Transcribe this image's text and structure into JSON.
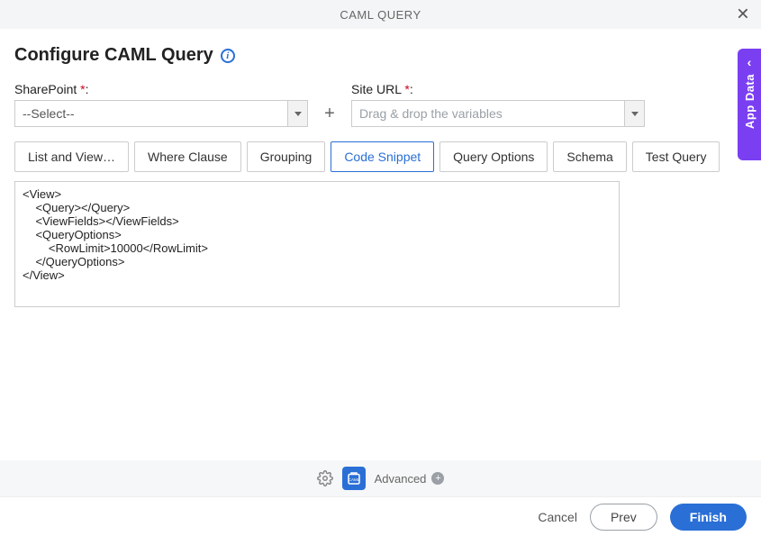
{
  "header": {
    "title": "CAML QUERY"
  },
  "page": {
    "title": "Configure CAML Query"
  },
  "fields": {
    "sharepoint": {
      "label": "SharePoint",
      "required": "*",
      "value": "--Select--"
    },
    "site_url": {
      "label": "Site URL",
      "required": "*",
      "placeholder": "Drag & drop the variables"
    }
  },
  "tabs": {
    "items": [
      {
        "label": "List and View…"
      },
      {
        "label": "Where Clause"
      },
      {
        "label": "Grouping"
      },
      {
        "label": "Code Snippet"
      },
      {
        "label": "Query Options"
      },
      {
        "label": "Schema"
      },
      {
        "label": "Test Query"
      }
    ],
    "active_index": 3
  },
  "code_snippet": "<View>\n    <Query></Query>\n    <ViewFields></ViewFields>\n    <QueryOptions>\n        <RowLimit>10000</RowLimit>\n    </QueryOptions>\n</View>",
  "bottom": {
    "advanced_label": "Advanced"
  },
  "footer": {
    "cancel": "Cancel",
    "prev": "Prev",
    "finish": "Finish"
  },
  "side_panel": {
    "label": "App Data"
  }
}
